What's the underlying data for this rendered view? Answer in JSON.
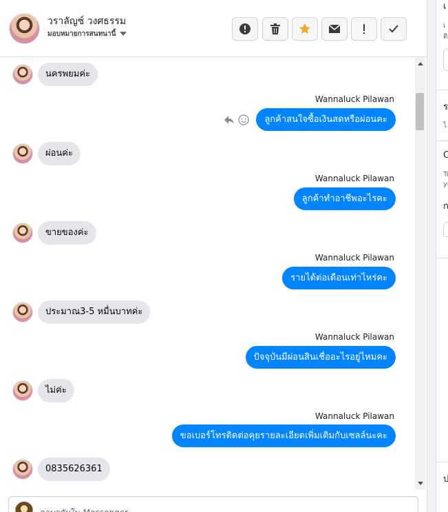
{
  "contact": {
    "name": "วราลัญช์ วงศธรรม",
    "subtitle": "มอบหมายการสนทนานี้"
  },
  "header_actions": [
    {
      "name": "report-button",
      "icon": "exclamation-circle-icon"
    },
    {
      "name": "delete-button",
      "icon": "trash-icon"
    },
    {
      "name": "star-button",
      "icon": "star-icon"
    },
    {
      "name": "mail-button",
      "icon": "envelope-icon"
    },
    {
      "name": "spam-button",
      "icon": "exclamation-icon"
    },
    {
      "name": "done-button",
      "icon": "checkmark-icon"
    }
  ],
  "messages": [
    {
      "dir": "in",
      "text": "นครพยมค่ะ"
    },
    {
      "dir": "out",
      "sender": "Wannaluck Pilawan",
      "text": "ลูกค้าสนใจซื้อเงินสดหรือผ่อนคะ"
    },
    {
      "dir": "in",
      "text": "ผ่อนค่ะ"
    },
    {
      "dir": "out",
      "sender": "Wannaluck Pilawan",
      "text": "ลูกค้าทำอาชีพอะไรคะ"
    },
    {
      "dir": "in",
      "text": "ขายของค่ะ"
    },
    {
      "dir": "out",
      "sender": "Wannaluck Pilawan",
      "text": "รายได้ต่อเดือนเท่าไหร่คะ"
    },
    {
      "dir": "in",
      "text": "ประมาณ3-5 หมื่นบาทค่ะ"
    },
    {
      "dir": "out",
      "sender": "Wannaluck Pilawan",
      "text": "ปัจจุบันมีผ่อนสินเชื่ออะไรอยู่ไหมคะ"
    },
    {
      "dir": "in",
      "text": "ไม่ค่ะ"
    },
    {
      "dir": "out",
      "sender": "Wannaluck Pilawan",
      "text": "ขอเบอร์โทรติดต่อคุยรายละเอียดเพิ่มเติมกับเซลล์นะคะ"
    },
    {
      "dir": "in",
      "text": "0835626361"
    }
  ],
  "composer": {
    "placeholder": "ตอบกลับใน Messenger"
  },
  "right_panel": {
    "top_letter": "เ",
    "top_small": "เ",
    "top_small2": "ติ",
    "mid_letter": "ร",
    "mid_small": "ไ",
    "mid2_letter": "C",
    "mid2_small": "Tr",
    "mid2_small2": "yc",
    "mid3_letter": "ก",
    "bottom_letter": "ป"
  },
  "colors": {
    "outgoing_bubble": "#0084ff",
    "incoming_bubble": "#e4e6eb",
    "star": "#f5a623"
  }
}
